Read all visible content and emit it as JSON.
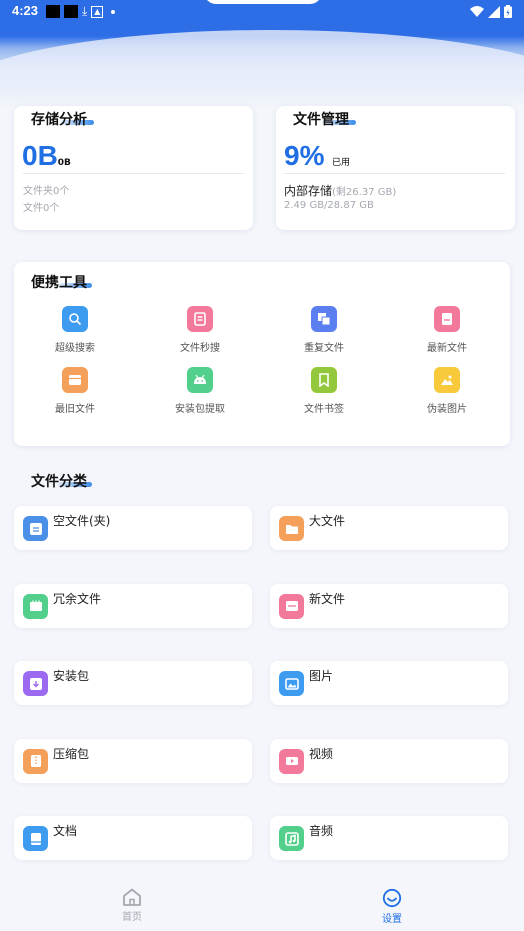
{
  "status": {
    "time": "4:23",
    "notification_icons": [
      "square-icon",
      "square-icon",
      "download-icon",
      "photo-icon",
      "dot-icon"
    ],
    "right_icons": [
      "wifi-icon",
      "signal-icon",
      "battery-icon"
    ]
  },
  "storage_analysis": {
    "title": "存储分析",
    "value": "0B",
    "unit": "0B",
    "folders_line": "文件夹0个",
    "files_line": "文件0个"
  },
  "file_management": {
    "title": "文件管理",
    "percent": "9%",
    "percent_suffix": "已用",
    "internal_label": "内部存储",
    "remaining": "(剩26.37 GB)",
    "usage": "2.49 GB/28.87 GB"
  },
  "tools": {
    "title": "便携工具",
    "items": [
      {
        "label": "超级搜索",
        "icon": "search-icon",
        "color": "#3d9cf0"
      },
      {
        "label": "文件秒搜",
        "icon": "document-icon",
        "color": "#f2799a"
      },
      {
        "label": "重复文件",
        "icon": "duplicate-icon",
        "color": "#5b7ff0"
      },
      {
        "label": "最新文件",
        "icon": "new-badge-icon",
        "color": "#f2799a"
      },
      {
        "label": "最旧文件",
        "icon": "archive-box-icon",
        "color": "#f5a05a"
      },
      {
        "label": "安装包提取",
        "icon": "android-icon",
        "color": "#52cf8b"
      },
      {
        "label": "文件书签",
        "icon": "bookmark-icon",
        "color": "#94c83c"
      },
      {
        "label": "伪装图片",
        "icon": "image-icon",
        "color": "#f8c93b"
      }
    ]
  },
  "categories": {
    "title": "文件分类",
    "items": [
      {
        "label": "空文件(夹)",
        "icon": "empty-folder-icon",
        "color": "#4a90e8"
      },
      {
        "label": "大文件",
        "icon": "large-folder-icon",
        "color": "#f5a05a"
      },
      {
        "label": "冗余文件",
        "icon": "redundant-icon",
        "color": "#52cf8b"
      },
      {
        "label": "新文件",
        "icon": "new-file-icon",
        "color": "#f2799a"
      },
      {
        "label": "安装包",
        "icon": "install-package-icon",
        "color": "#9b6af0"
      },
      {
        "label": "图片",
        "icon": "picture-icon",
        "color": "#3d9cf0"
      },
      {
        "label": "压缩包",
        "icon": "zip-icon",
        "color": "#f5a05a"
      },
      {
        "label": "视频",
        "icon": "video-icon",
        "color": "#f2799a"
      },
      {
        "label": "文档",
        "icon": "doc-icon",
        "color": "#3d9cf0"
      },
      {
        "label": "音频",
        "icon": "music-icon",
        "color": "#52cf8b"
      }
    ]
  },
  "tabbar": {
    "home_label": "首页",
    "settings_label": "设置",
    "active_color": "#1f6ee3",
    "inactive_color": "#a5a8b0"
  }
}
